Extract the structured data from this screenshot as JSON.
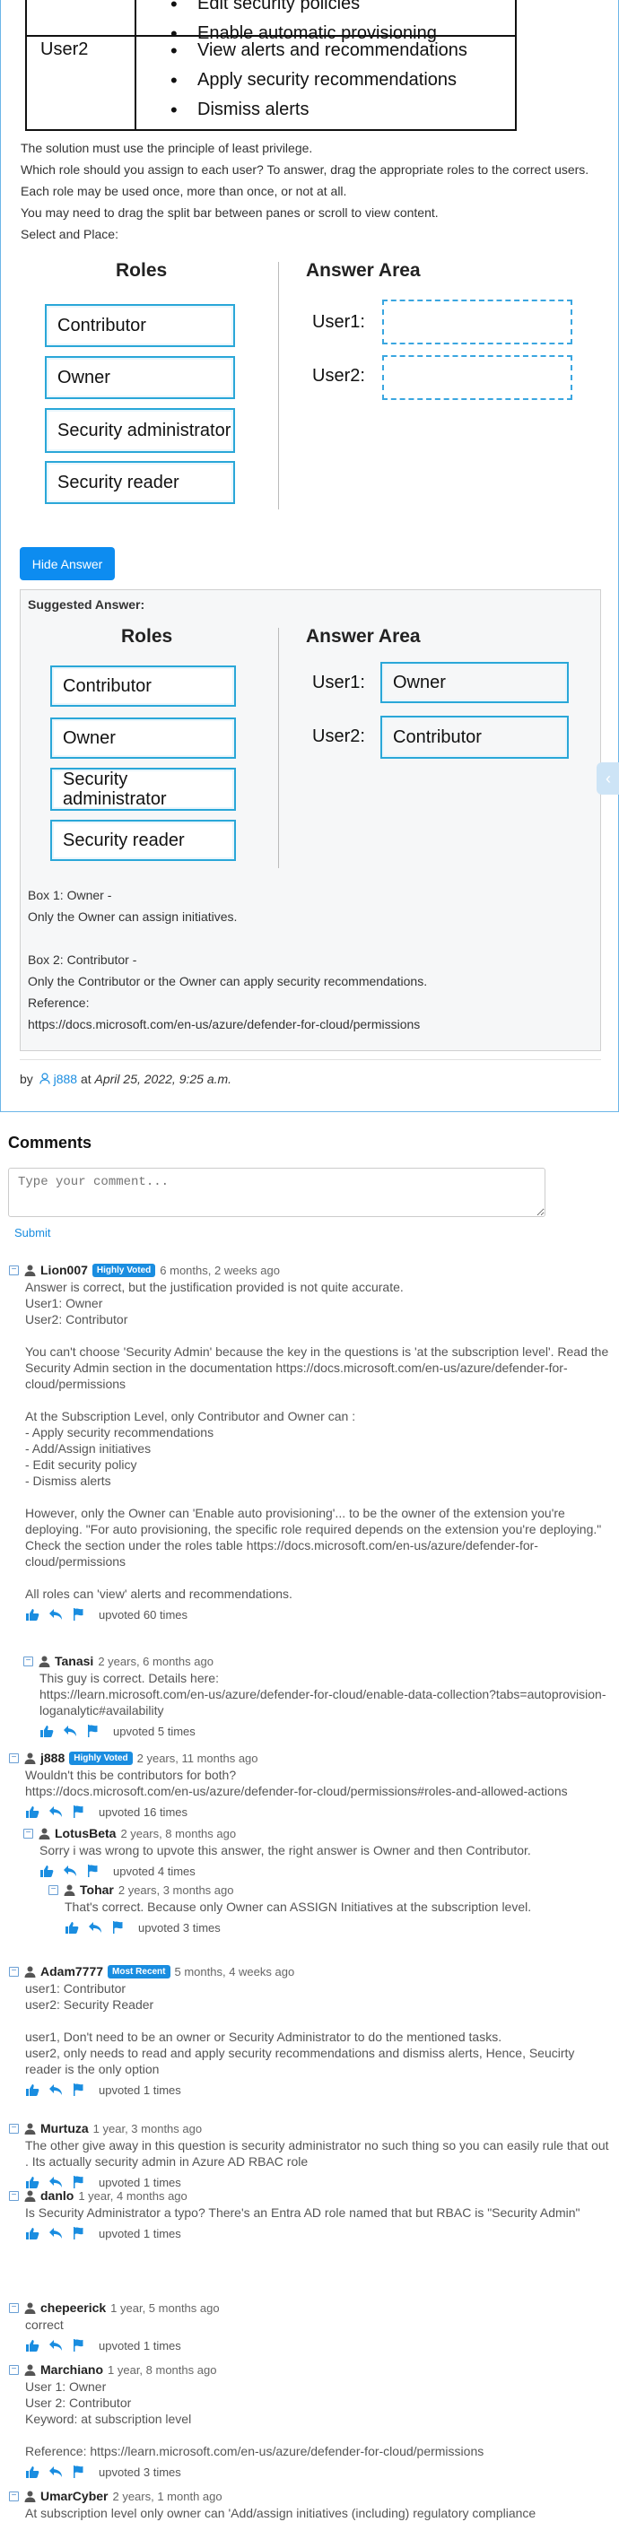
{
  "table": {
    "rows": [
      {
        "user": "",
        "items": [
          "Edit security policies",
          "Enable automatic provisioning"
        ]
      },
      {
        "user": "User2",
        "items": [
          "View alerts and recommendations",
          "Apply security recommendations",
          "Dismiss alerts"
        ]
      }
    ]
  },
  "question": {
    "lines": [
      "The solution must use the principle of least privilege.",
      "Which role should you assign to each user? To answer, drag the appropriate roles to the correct users.",
      "Each role may be used once, more than once, or not at all.",
      "You may need to drag the split bar between panes or scroll to view content.",
      "Select and Place:"
    ]
  },
  "panel": {
    "roles_title": "Roles",
    "answer_title": "Answer Area",
    "roles": [
      "Contributor",
      "Owner",
      "Security administrator",
      "Security reader"
    ],
    "users": [
      "User1:",
      "User2:"
    ]
  },
  "hide_answer_label": "Hide Answer",
  "suggested": {
    "header": "Suggested Answer:",
    "answers": [
      "Owner",
      "Contributor"
    ],
    "explanation": [
      "Box 1: Owner -",
      "Only the Owner can assign initiatives.",
      "",
      "Box 2: Contributor -",
      "Only the Contributor or the Owner can apply security recommendations.",
      "Reference:",
      "https://docs.microsoft.com/en-us/azure/defender-for-cloud/permissions"
    ]
  },
  "byline": {
    "by": "by",
    "author": "j888",
    "at": "at",
    "date": "April 25, 2022, 9:25 a.m."
  },
  "comments_section": {
    "title": "Comments",
    "placeholder": "Type your comment...",
    "submit": "Submit"
  },
  "comments": [
    {
      "user": "Lion007",
      "badge": "Highly Voted",
      "ago": "6 months, 2 weeks ago",
      "body": "Answer is correct, but the justification provided is not quite accurate.\nUser1: Owner\nUser2: Contributor\n\nYou can't choose 'Security Admin' because the key in the questions is 'at the subscription level'. Read the Security Admin section in the documentation https://docs.microsoft.com/en-us/azure/defender-for-cloud/permissions\n\nAt the Subscription Level, only Contributor and Owner can :\n- Apply security recommendations\n- Add/Assign initiatives\n- Edit security policy\n- Dismiss alerts\n\nHowever, only the Owner can 'Enable auto provisioning'... to be the owner of the extension you're deploying. \"For auto provisioning, the specific role required depends on the extension you're deploying.\" Check the section under the roles table https://docs.microsoft.com/en-us/azure/defender-for-cloud/permissions\n\nAll roles can 'view' alerts and recommendations.",
      "votes": "upvoted 60 times"
    },
    {
      "user": "Tanasi",
      "badge": "",
      "ago": "2 years, 6 months ago",
      "body": "This guy is correct. Details here:\nhttps://learn.microsoft.com/en-us/azure/defender-for-cloud/enable-data-collection?tabs=autoprovision-loganalytic#availability",
      "votes": "upvoted 5 times"
    },
    {
      "user": "j888",
      "badge": "Highly Voted",
      "ago": "2 years, 11 months ago",
      "body": "Wouldn't this be contributors for both?\nhttps://docs.microsoft.com/en-us/azure/defender-for-cloud/permissions#roles-and-allowed-actions",
      "votes": "upvoted 16 times"
    },
    {
      "user": "LotusBeta",
      "badge": "",
      "ago": "2 years, 8 months ago",
      "body": "Sorry i was wrong to upvote this answer, the right answer is Owner and then Contributor.",
      "votes": "upvoted 4 times"
    },
    {
      "user": "Tohar",
      "badge": "",
      "ago": "2 years, 3 months ago",
      "body": "That's correct. Because only Owner can ASSIGN Initiatives at the subscription level.",
      "votes": "upvoted 3 times"
    },
    {
      "user": "Adam7777",
      "badge": "Most Recent",
      "ago": "5 months, 4 weeks ago",
      "body": "user1: Contributor\nuser2: Security Reader\n\nuser1, Don't need to be an owner or Security Administrator to do the mentioned tasks.\nuser2, only needs to read and apply security recommendations and dismiss alerts, Hence, Seucirty reader is the only option",
      "votes": "upvoted 1 times"
    },
    {
      "user": "Murtuza",
      "badge": "",
      "ago": "1 year, 3 months ago",
      "body": "The other give away in this question is security administrator no such thing so you can easily rule that out . Its actually security admin in Azure AD RBAC role",
      "votes": "upvoted 1 times"
    },
    {
      "user": "danlo",
      "badge": "",
      "ago": "1 year, 4 months ago",
      "body": "Is Security Administrator a typo? There's an Entra AD role named that but RBAC is \"Security Admin\"",
      "votes": "upvoted 1 times"
    },
    {
      "user": "chepeerick",
      "badge": "",
      "ago": "1 year, 5 months ago",
      "body": "correct",
      "votes": "upvoted 1 times"
    },
    {
      "user": "Marchiano",
      "badge": "",
      "ago": "1 year, 8 months ago",
      "body": "User 1: Owner\nUser 2: Contributor\nKeyword: at subscription level\n\nReference: https://learn.microsoft.com/en-us/azure/defender-for-cloud/permissions",
      "votes": "upvoted 3 times"
    },
    {
      "user": "UmarCyber",
      "badge": "",
      "ago": "2 years, 1 month ago",
      "body": "At subscription level only owner can 'Add/assign initiatives (including) regulatory compliance",
      "votes": ""
    }
  ],
  "colors": {
    "accent": "#1a8de0",
    "button": "#0d8cf0",
    "box_border": "#2aa7d8",
    "card_border": "#6cb6e8"
  },
  "icons": [
    "user-icon",
    "thumbs-up-icon",
    "reply-icon",
    "flag-icon",
    "collapse-icon",
    "chevron-left-icon",
    "person-outline-icon"
  ]
}
